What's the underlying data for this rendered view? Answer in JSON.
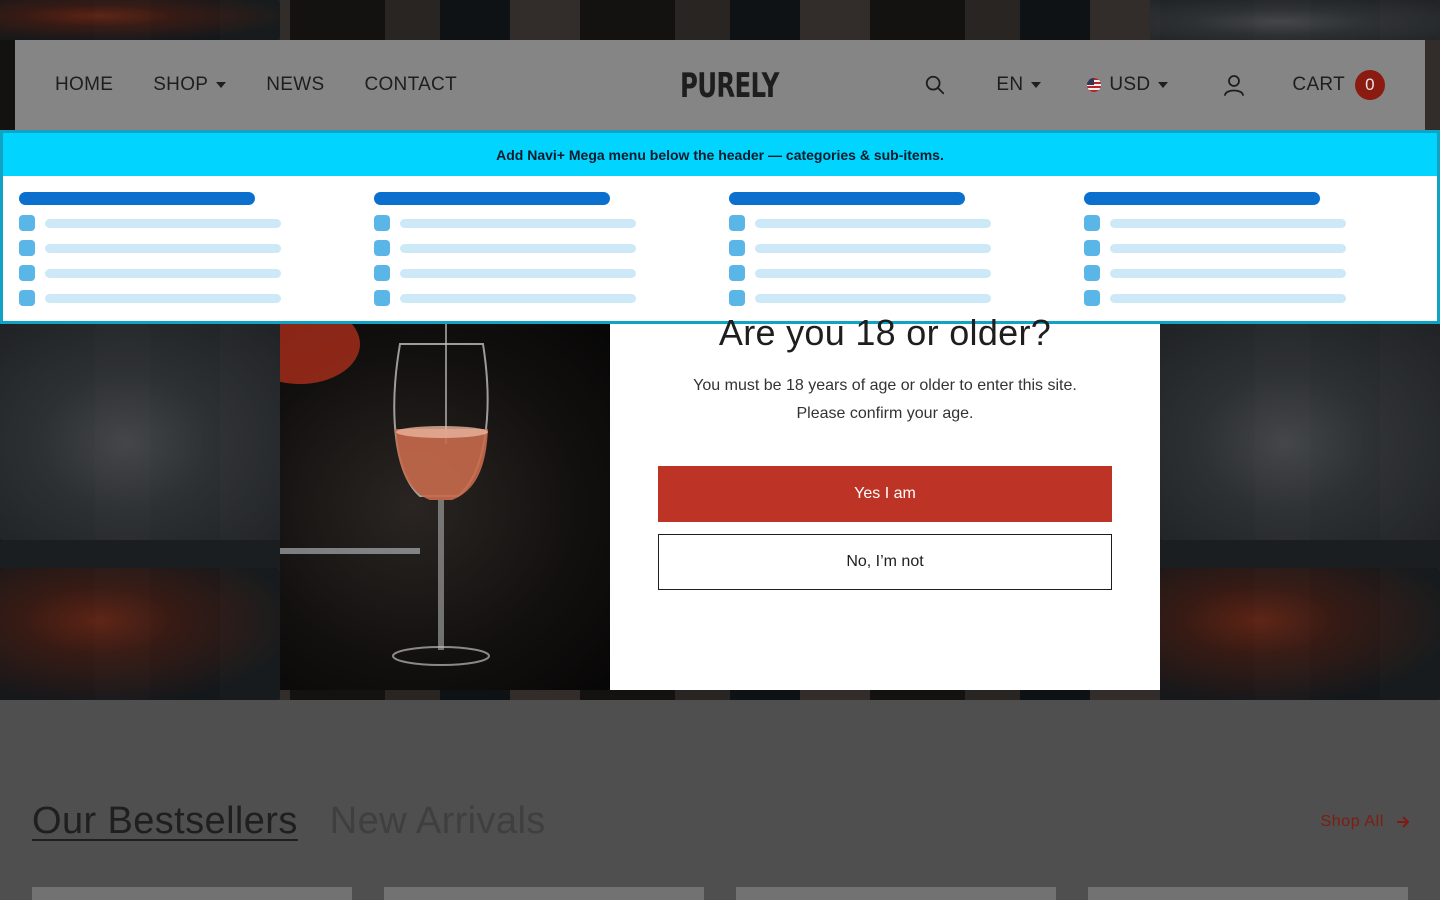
{
  "header": {
    "nav": [
      {
        "label": "HOME",
        "has_dropdown": false
      },
      {
        "label": "SHOP",
        "has_dropdown": true
      },
      {
        "label": "NEWS",
        "has_dropdown": false
      },
      {
        "label": "CONTACT",
        "has_dropdown": false
      }
    ],
    "logo": "PURELY",
    "language": "EN",
    "currency": "USD",
    "cart_label": "CART",
    "cart_count": "0",
    "icons": [
      "search-icon",
      "user-icon",
      "us-flag-icon",
      "chevron-down-icon"
    ]
  },
  "mega_menu": {
    "banner": "Add Navi+ Mega menu below the header — categories & sub-items.",
    "columns": 4,
    "rows_per_column": 4,
    "colors": {
      "banner": "#00d4ff",
      "heading": "#0b6fce",
      "dot": "#5ab6e6",
      "line": "#cde9f8"
    }
  },
  "age_popup": {
    "title": "Are you 18 or older?",
    "line1": "You must be 18 years of age or older to enter this site.",
    "line2": "Please confirm your age.",
    "yes_label": "Yes I am",
    "no_label": "No, I’m not",
    "colors": {
      "yes_button": "#bd3325"
    }
  },
  "collections": {
    "tabs": [
      {
        "label": "Our Bestsellers",
        "active": true
      },
      {
        "label": "New Arrivals",
        "active": false
      }
    ],
    "shop_all_label": "Shop All"
  }
}
